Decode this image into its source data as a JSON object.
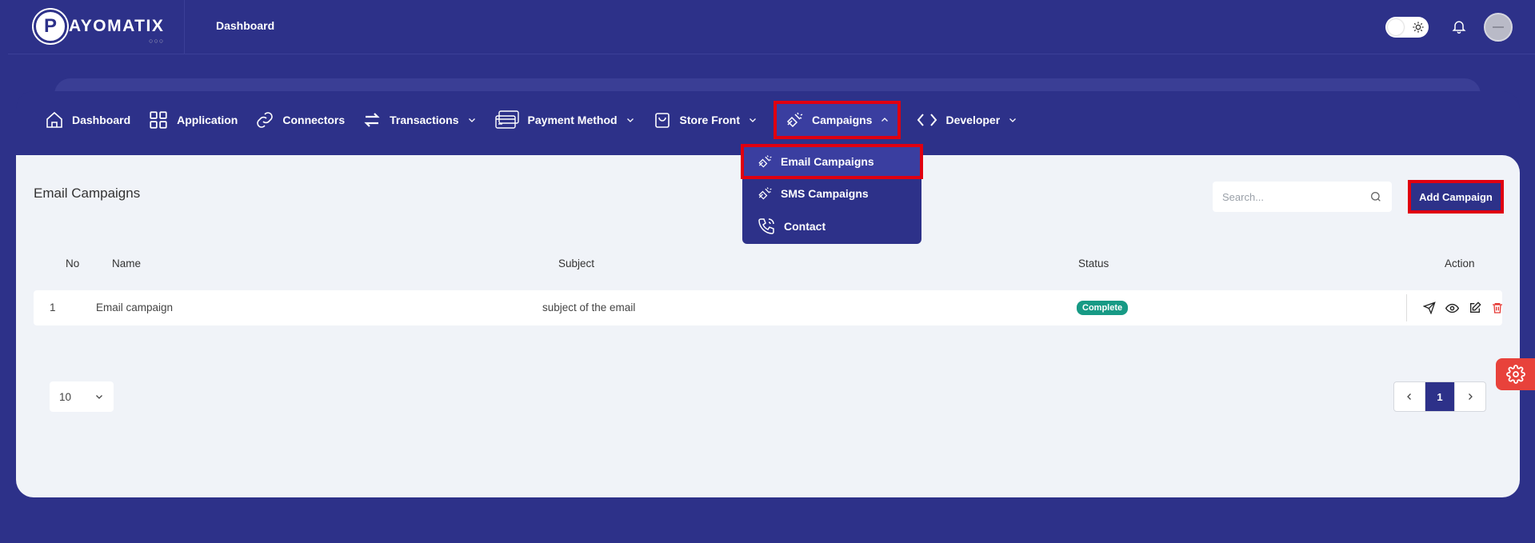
{
  "brand": {
    "logo_letter": "P",
    "logo_text": "AYOMATIX",
    "logo_dots": "○○○"
  },
  "topbar": {
    "title": "Dashboard"
  },
  "nav": {
    "items": [
      {
        "label": "Dashboard",
        "icon": "home-icon"
      },
      {
        "label": "Application",
        "icon": "grid-icon"
      },
      {
        "label": "Connectors",
        "icon": "link-icon"
      },
      {
        "label": "Transactions",
        "icon": "swap-arrows-icon",
        "dropdown": true
      },
      {
        "label": "Payment Method",
        "icon": "cards-icon",
        "dropdown": true
      },
      {
        "label": "Store Front",
        "icon": "bag-icon",
        "dropdown": true
      },
      {
        "label": "Campaigns",
        "icon": "megaphone-icon",
        "dropdown": true,
        "open": true
      },
      {
        "label": "Developer",
        "icon": "code-icon",
        "dropdown": true
      }
    ]
  },
  "campaigns_menu": {
    "items": [
      {
        "label": "Email Campaigns",
        "icon": "megaphone-icon"
      },
      {
        "label": "SMS Campaigns",
        "icon": "megaphone-icon"
      },
      {
        "label": "Contact",
        "icon": "phone-icon"
      }
    ]
  },
  "page": {
    "title": "Email Campaigns",
    "search_placeholder": "Search...",
    "add_button": "Add Campaign"
  },
  "table": {
    "headers": {
      "no": "No",
      "name": "Name",
      "subject": "Subject",
      "status": "Status",
      "action": "Action"
    },
    "rows": [
      {
        "no": "1",
        "name": "Email campaign",
        "subject": "subject of the email",
        "status": "Complete"
      }
    ]
  },
  "pagination": {
    "page_size": "10",
    "current_page": "1"
  },
  "colors": {
    "primary": "#2d3189",
    "highlight": "#e00010",
    "status_complete": "#179a85",
    "settings_fab": "#e8423b",
    "card_bg": "#f0f3f8"
  }
}
